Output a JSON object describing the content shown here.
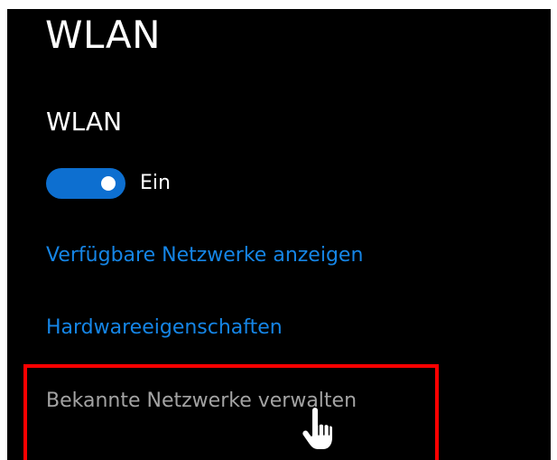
{
  "page": {
    "title": "WLAN"
  },
  "wlan_section": {
    "title": "WLAN",
    "toggle_state": "Ein",
    "toggle_on": true
  },
  "links": {
    "available_networks": "Verfügbare Netzwerke anzeigen",
    "hardware_properties": "Hardwareeigenschaften",
    "manage_known_networks": "Bekannte Netzwerke verwalten"
  },
  "colors": {
    "background": "#000000",
    "accent": "#0d6fd0",
    "link": "#1585e6",
    "highlight": "#ff0000",
    "muted_link": "#a3a3a3"
  },
  "icons": {
    "toggle": "toggle-switch-icon",
    "cursor": "hand-pointer-icon"
  }
}
